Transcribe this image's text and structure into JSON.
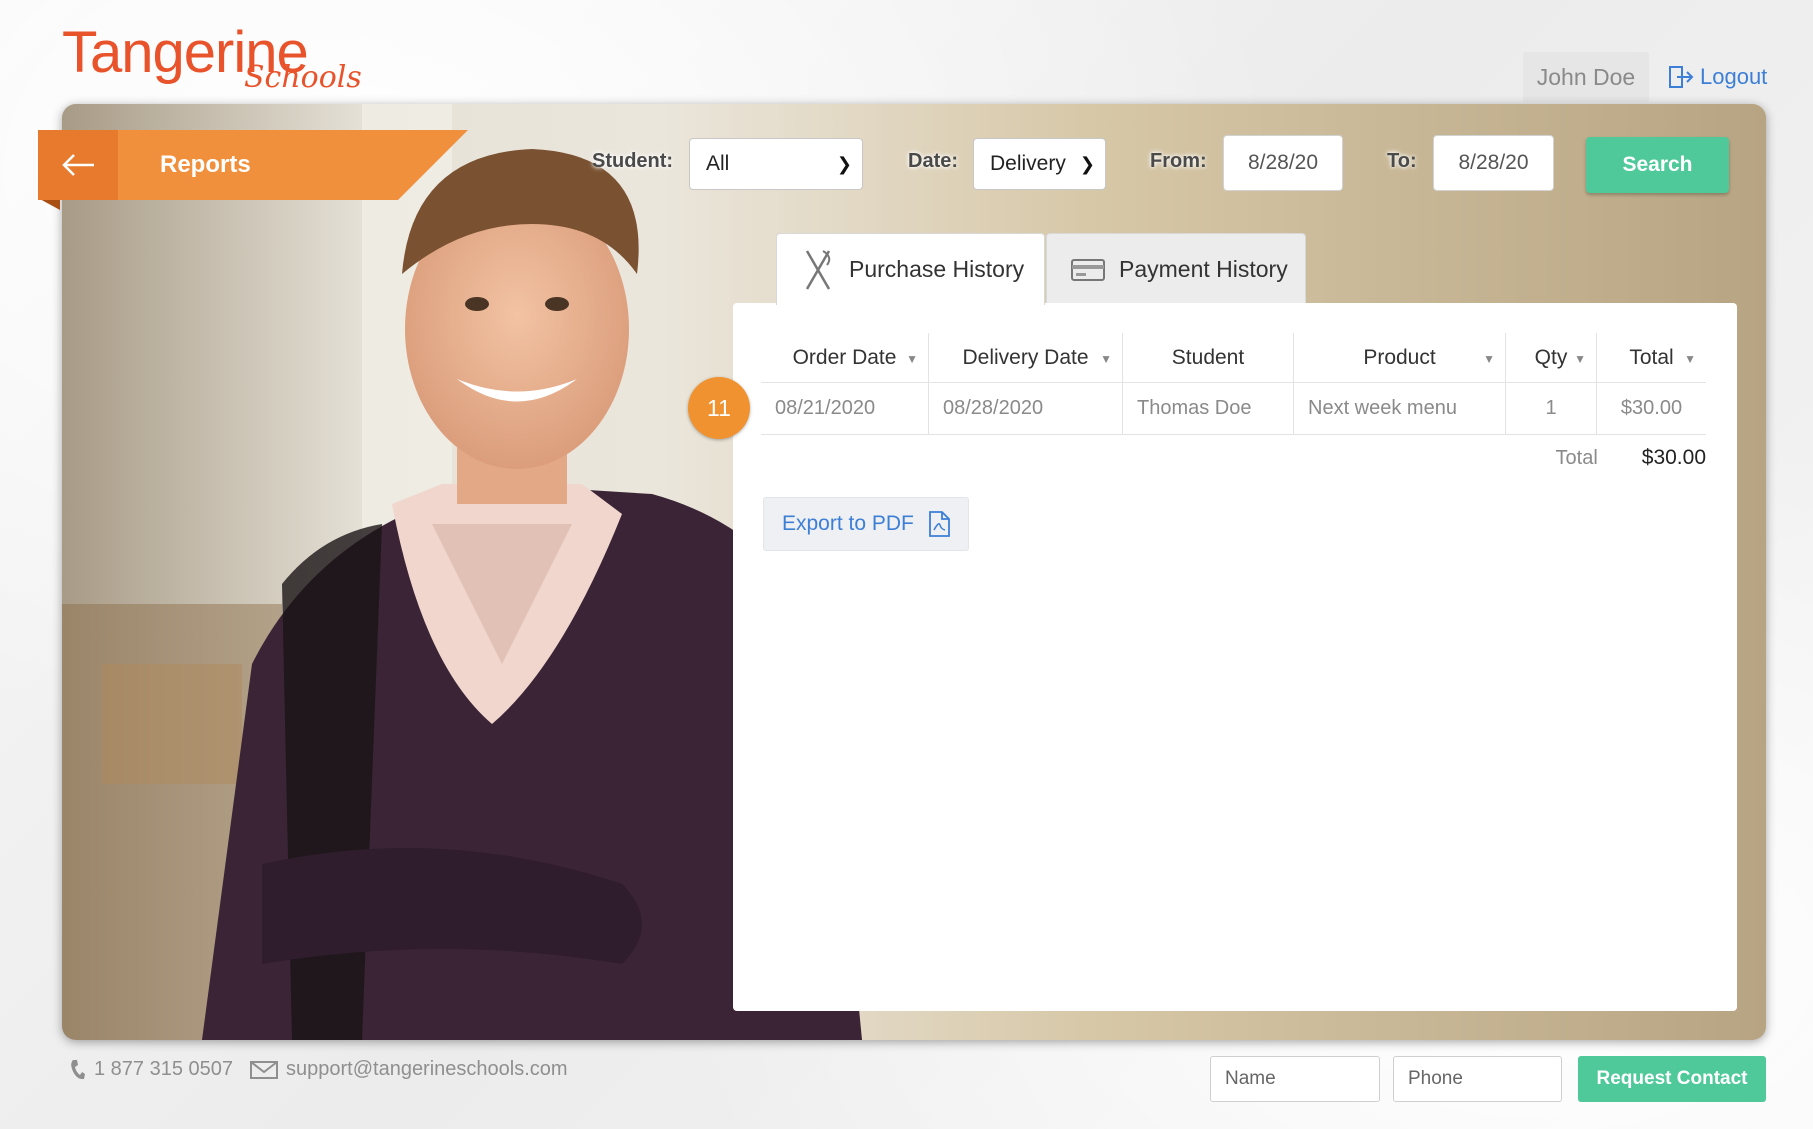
{
  "brand": {
    "name": "Tangerine",
    "subname": "Schools",
    "accent_color": "#e8532b"
  },
  "header": {
    "user_name": "John Doe",
    "logout_label": "Logout"
  },
  "section": {
    "title": "Reports"
  },
  "filters": {
    "student_label": "Student:",
    "student_value": "All",
    "date_label": "Date:",
    "date_value": "Delivery",
    "from_label": "From:",
    "from_value": "8/28/20",
    "to_label": "To:",
    "to_value": "8/28/20",
    "search_label": "Search"
  },
  "tabs": [
    {
      "label": "Purchase History",
      "icon": "utensils-icon",
      "active": true
    },
    {
      "label": "Payment History",
      "icon": "credit-card-icon",
      "active": false
    }
  ],
  "table": {
    "columns": [
      "Order Date",
      "Delivery Date",
      "Student",
      "Product",
      "Qty",
      "Total"
    ],
    "rows": [
      [
        "08/21/2020",
        "08/28/2020",
        "Thomas Doe",
        "Next week menu",
        "1",
        "$30.00"
      ]
    ],
    "total_label": "Total",
    "total_value": "$30.00"
  },
  "export_label": "Export to PDF",
  "step_badge": "11",
  "footer": {
    "phone": "1 877 315 0507",
    "email": "support@tangerineschools.com",
    "name_placeholder": "Name",
    "phone_placeholder": "Phone",
    "request_label": "Request Contact"
  },
  "colors": {
    "orange": "#f1903c",
    "green": "#4fc99a",
    "link_blue": "#3d7fd6"
  }
}
